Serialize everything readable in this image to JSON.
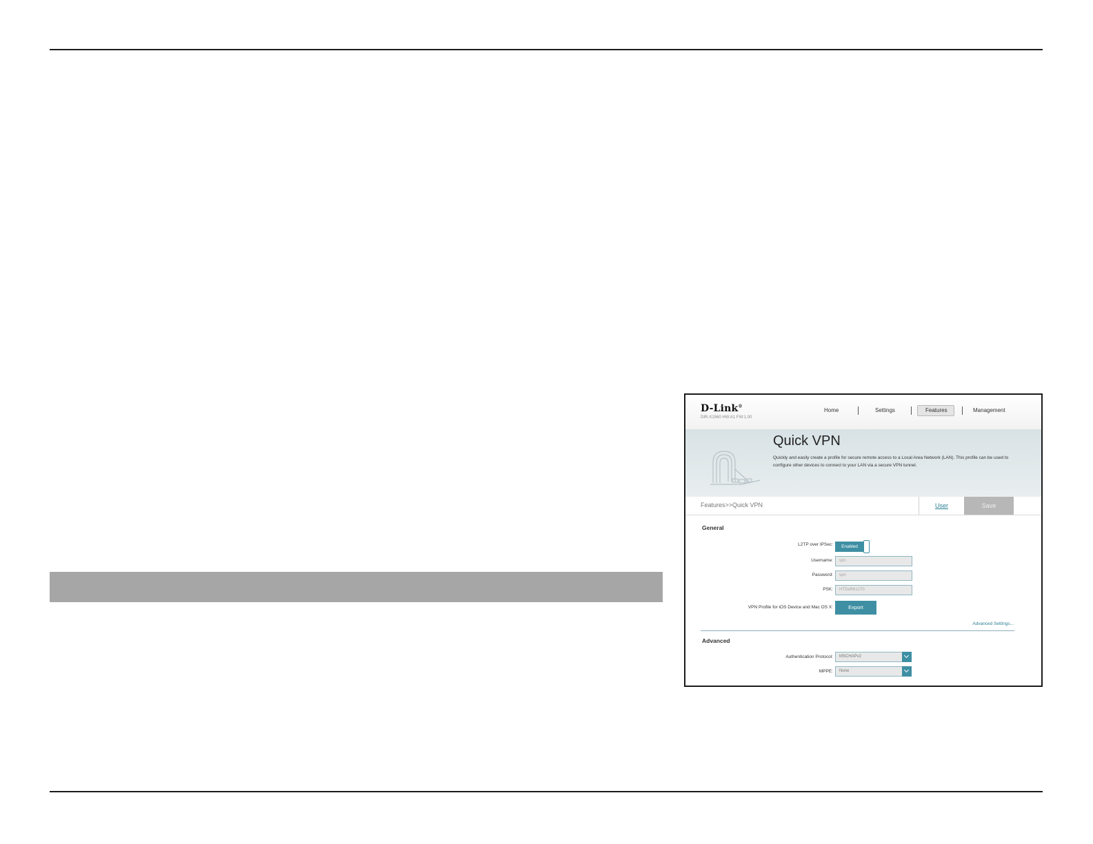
{
  "router": {
    "logo": "D-Link",
    "logo_mark": "®",
    "model": "DIR-X1560 HW:A1 FW:1.00",
    "nav": {
      "home": "Home",
      "settings": "Settings",
      "features": "Features",
      "management": "Management"
    },
    "banner": {
      "title": "Quick VPN",
      "description": "Quickly and easily create a profile for secure remote access to a Local Area Network (LAN). This profile can be used to configure other devices to connect to your LAN via a secure VPN tunnel."
    },
    "breadcrumb": "Features>>Quick VPN",
    "user_link": "User",
    "save_button": "Save",
    "general": {
      "heading": "General",
      "l2tp_label": "L2TP over IPSec:",
      "l2tp_state": "Enabled",
      "username_label": "Username:",
      "username_value": "vpn",
      "password_label": "Password:",
      "password_value": "vpn",
      "psk_label": "PSK:",
      "psk_value": "HTDeR61270",
      "vpn_profile_label": "VPN Profile for iOS Device and Mac OS X:",
      "export_button": "Export",
      "advanced_link": "Advanced Settings..."
    },
    "advanced": {
      "heading": "Advanced",
      "auth_label": "Authentication Protocol:",
      "auth_value": "MSCHAPv2",
      "mppe_label": "MPPE:",
      "mppe_value": "None"
    }
  },
  "colors": {
    "accent": "#3e8fa3",
    "link": "#2a7f93",
    "save_disabled": "#b7b7b7",
    "grey_bar": "#a6a6a6"
  }
}
